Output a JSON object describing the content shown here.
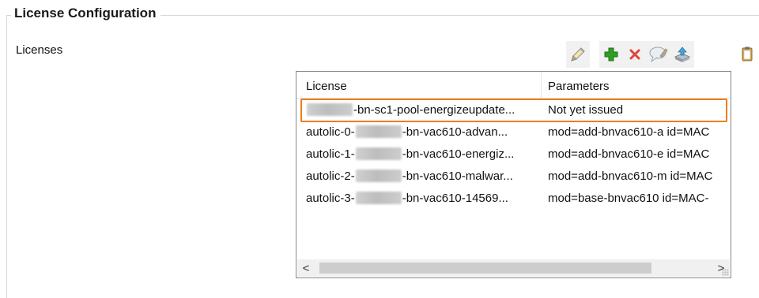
{
  "section": {
    "title": "License Configuration"
  },
  "field": {
    "label": "Licenses"
  },
  "toolbar": {
    "buttons": [
      {
        "name": "edit-icon"
      },
      {
        "name": "add-icon"
      },
      {
        "name": "delete-icon"
      },
      {
        "name": "comment-icon"
      },
      {
        "name": "export-icon"
      },
      {
        "name": "paste-icon"
      }
    ],
    "colors": {
      "add": "#2e9e20",
      "delete": "#e0453a"
    }
  },
  "grid": {
    "columns": [
      "License",
      "Parameters"
    ],
    "rows": [
      {
        "prefix": "",
        "suffix": "-bn-sc1-pool-energizeupdate...",
        "parameters": "Not yet issued"
      },
      {
        "prefix": "autolic-0-",
        "suffix": "-bn-vac610-advan...",
        "parameters": "mod=add-bnvac610-a id=MAC"
      },
      {
        "prefix": "autolic-1-",
        "suffix": "-bn-vac610-energiz...",
        "parameters": "mod=add-bnvac610-e id=MAC"
      },
      {
        "prefix": "autolic-2-",
        "suffix": "-bn-vac610-malwar...",
        "parameters": "mod=add-bnvac610-m id=MAC"
      },
      {
        "prefix": "autolic-3-",
        "suffix": "-bn-vac610-14569...",
        "parameters": "mod=base-bnvac610 id=MAC-"
      }
    ],
    "selected_row": 0,
    "highlight_color": "#f07c1a"
  },
  "scrollbar": {
    "left_arrow": "<",
    "right_arrow": ">"
  }
}
